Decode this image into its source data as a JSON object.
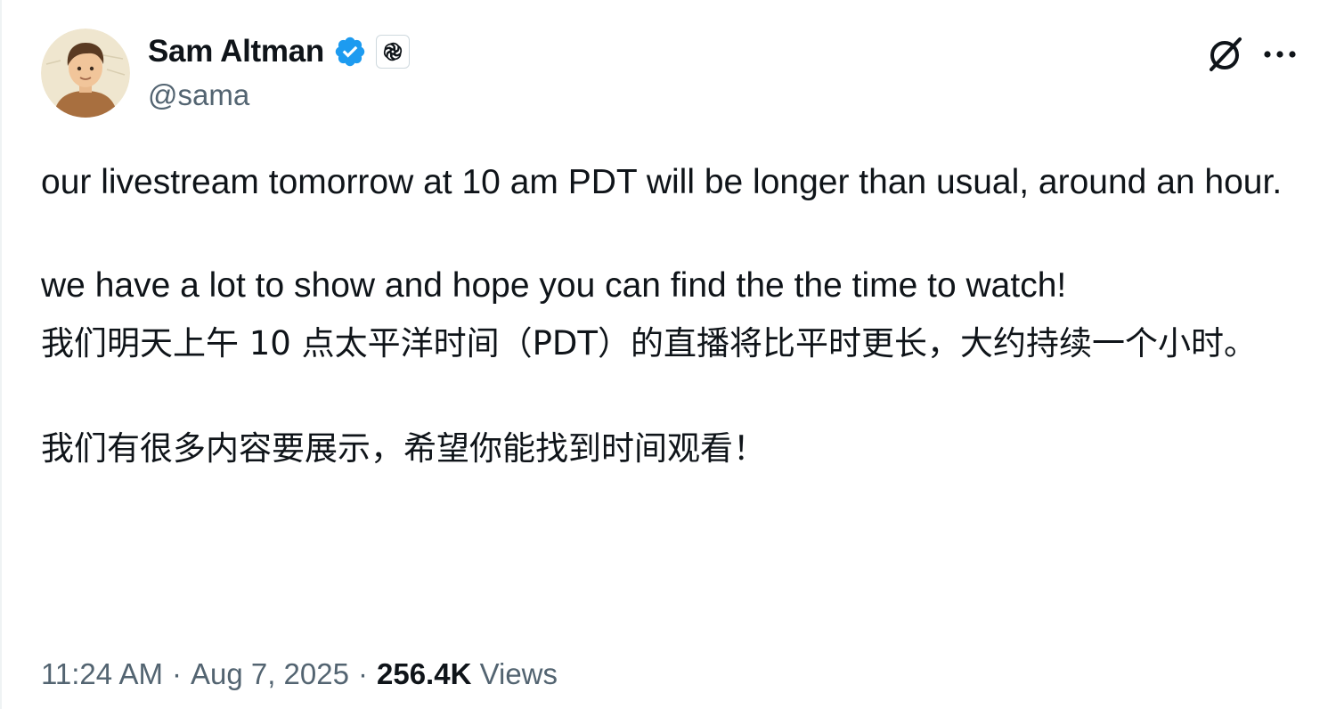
{
  "author": {
    "display_name": "Sam Altman",
    "handle": "@sama",
    "verified": true,
    "verified_color": "#1d9bf0",
    "affiliate_badge_icon": "openai-logo-icon"
  },
  "actions": {
    "grok_icon": "grok-icon",
    "more_icon": "more-icon"
  },
  "tweet": {
    "paragraphs": [
      "our livestream tomorrow at 10 am PDT will be longer than usual, around an hour.",
      "we have a lot to show and hope you can find the the time to watch!",
      "我们明天上午 10 点太平洋时间（PDT）的直播将比平时更长，大约持续一个小时。",
      "我们有很多内容要展示，希望你能找到时间观看！"
    ]
  },
  "meta": {
    "time": "11:24 AM",
    "separator": "·",
    "date": "Aug 7, 2025",
    "views_count": "256.4K",
    "views_label": "Views"
  }
}
